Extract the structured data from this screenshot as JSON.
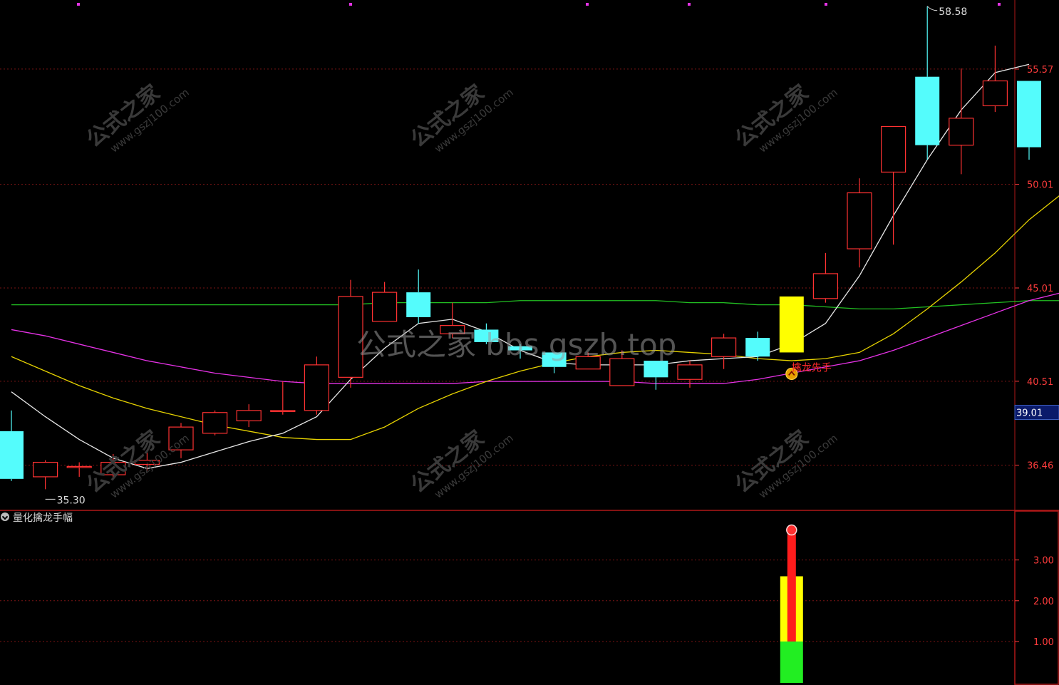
{
  "colors": {
    "up": "#ff3232",
    "down": "#54fcfc",
    "signal": "#ffff00",
    "ma_white": "#e6e6e6",
    "ma_yellow": "#e6d200",
    "ma_magenta": "#e632e6",
    "ma_green": "#22c022",
    "grid": "#7a1414",
    "axis_text": "#ff3c3c"
  },
  "watermark": {
    "site_cn": "公式之家",
    "site_url": "www.gszj100.com",
    "center_text": "公式之家 bbs.gszb.top"
  },
  "chart_data": [
    {
      "type": "candlestick",
      "y_ticks": [
        "55.57",
        "50.01",
        "45.01",
        "40.51",
        "36.46"
      ],
      "price_marker": "39.01",
      "ylim": [
        33.0,
        59.3
      ],
      "max_label": "58.58",
      "min_label": "35.30",
      "signal_label": "擒龙先手",
      "candles": [
        {
          "o": 38.1,
          "h": 39.1,
          "l": 35.7,
          "c": 35.8
        },
        {
          "o": 35.9,
          "h": 36.7,
          "l": 35.3,
          "c": 36.6
        },
        {
          "o": 36.4,
          "h": 36.6,
          "l": 35.9,
          "c": 36.4
        },
        {
          "o": 36.0,
          "h": 37.0,
          "l": 35.8,
          "c": 36.6
        },
        {
          "o": 36.5,
          "h": 37.2,
          "l": 36.2,
          "c": 36.7
        },
        {
          "o": 37.2,
          "h": 38.5,
          "l": 36.8,
          "c": 38.3
        },
        {
          "o": 38.0,
          "h": 39.1,
          "l": 37.9,
          "c": 39.0
        },
        {
          "o": 38.6,
          "h": 39.4,
          "l": 38.3,
          "c": 39.1
        },
        {
          "o": 39.1,
          "h": 40.5,
          "l": 38.9,
          "c": 39.1
        },
        {
          "o": 39.1,
          "h": 41.7,
          "l": 38.9,
          "c": 41.3
        },
        {
          "o": 40.7,
          "h": 45.4,
          "l": 40.2,
          "c": 44.6
        },
        {
          "o": 43.4,
          "h": 45.3,
          "l": 43.4,
          "c": 44.8
        },
        {
          "o": 44.8,
          "h": 45.9,
          "l": 43.3,
          "c": 43.6
        },
        {
          "o": 42.8,
          "h": 44.3,
          "l": 42.6,
          "c": 43.2
        },
        {
          "o": 43.0,
          "h": 43.3,
          "l": 42.3,
          "c": 42.4
        },
        {
          "o": 42.2,
          "h": 42.3,
          "l": 41.6,
          "c": 42.0
        },
        {
          "o": 41.9,
          "h": 41.9,
          "l": 40.9,
          "c": 41.2
        },
        {
          "o": 41.1,
          "h": 41.9,
          "l": 41.1,
          "c": 41.7
        },
        {
          "o": 40.3,
          "h": 42.0,
          "l": 40.3,
          "c": 41.6
        },
        {
          "o": 41.5,
          "h": 41.5,
          "l": 40.1,
          "c": 40.7
        },
        {
          "o": 40.6,
          "h": 41.5,
          "l": 40.2,
          "c": 41.3
        },
        {
          "o": 41.7,
          "h": 42.8,
          "l": 41.1,
          "c": 42.6
        },
        {
          "o": 42.6,
          "h": 42.9,
          "l": 41.5,
          "c": 41.7
        },
        {
          "o": 44.6,
          "h": 44.6,
          "l": 41.9,
          "c": 41.9
        },
        {
          "o": 44.5,
          "h": 46.7,
          "l": 44.3,
          "c": 45.7
        },
        {
          "o": 46.9,
          "h": 50.3,
          "l": 46.0,
          "c": 49.6
        },
        {
          "o": 50.6,
          "h": 51.1,
          "l": 47.1,
          "c": 52.8
        },
        {
          "o": 55.2,
          "h": 58.6,
          "l": 51.2,
          "c": 51.9
        },
        {
          "o": 51.9,
          "h": 55.6,
          "l": 50.5,
          "c": 53.2
        },
        {
          "o": 53.8,
          "h": 56.7,
          "l": 53.5,
          "c": 55.0
        },
        {
          "o": 55.0,
          "h": 55.0,
          "l": 51.2,
          "c": 51.8
        }
      ],
      "candle_color_override": {
        "23": "signal"
      },
      "ma_series": [
        {
          "color": "ma_green",
          "values": [
            44.2,
            44.2,
            44.2,
            44.2,
            44.2,
            44.2,
            44.2,
            44.2,
            44.2,
            44.2,
            44.2,
            44.3,
            44.3,
            44.3,
            44.3,
            44.4,
            44.4,
            44.4,
            44.4,
            44.4,
            44.3,
            44.3,
            44.2,
            44.2,
            44.1,
            44.0,
            44.0,
            44.1,
            44.2,
            44.3,
            44.4,
            44.4
          ]
        },
        {
          "color": "ma_magenta",
          "values": [
            43.0,
            42.7,
            42.3,
            41.9,
            41.5,
            41.2,
            40.9,
            40.7,
            40.5,
            40.4,
            40.4,
            40.4,
            40.4,
            40.4,
            40.5,
            40.5,
            40.5,
            40.5,
            40.5,
            40.4,
            40.4,
            40.4,
            40.6,
            40.9,
            41.2,
            41.5,
            42.0,
            42.6,
            43.2,
            43.8,
            44.4,
            44.8,
            45.2
          ]
        },
        {
          "color": "ma_yellow",
          "values": [
            41.7,
            41.0,
            40.3,
            39.7,
            39.2,
            38.8,
            38.4,
            38.1,
            37.8,
            37.7,
            37.7,
            38.3,
            39.2,
            39.9,
            40.5,
            41.0,
            41.4,
            41.7,
            41.9,
            42.0,
            41.9,
            41.8,
            41.6,
            41.5,
            41.6,
            41.9,
            42.8,
            44.0,
            45.3,
            46.7,
            48.3,
            49.6
          ]
        },
        {
          "color": "ma_white",
          "values": [
            40.0,
            38.8,
            37.7,
            36.8,
            36.3,
            36.6,
            37.1,
            37.6,
            38.0,
            38.8,
            40.6,
            42.1,
            43.3,
            43.5,
            42.9,
            42.0,
            41.4,
            41.3,
            41.3,
            41.3,
            41.5,
            41.6,
            41.7,
            42.3,
            43.3,
            45.6,
            48.5,
            51.2,
            53.6,
            55.4,
            55.8
          ]
        }
      ]
    },
    {
      "type": "bar",
      "title": "量化擒龙手幅",
      "y_ticks": [
        "3.00",
        "2.00",
        "1.00"
      ],
      "ylim": [
        0.0,
        4.3
      ],
      "bar_index": 23,
      "segments": [
        {
          "from": 0.0,
          "to": 1.0,
          "color": "#22ee22"
        },
        {
          "from": 1.0,
          "to": 2.6,
          "color": "#ffff00"
        },
        {
          "from": 1.0,
          "to": 3.7,
          "color": "#ff1c1c",
          "narrow": true
        }
      ]
    }
  ]
}
